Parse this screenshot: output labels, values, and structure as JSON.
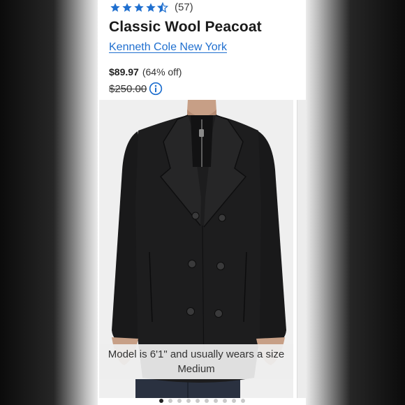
{
  "product": {
    "rating_count": "(57)",
    "title": "Classic Wool Peacoat",
    "brand": "Kenneth Cole New York",
    "price": "$89.97",
    "discount": "(64% off)",
    "original_price": "$250.00"
  },
  "rating": {
    "stars": 4.5,
    "max": 5,
    "color": "#1f6fcf"
  },
  "icons": {
    "star": "star-icon",
    "info": "info-icon"
  },
  "gallery": {
    "caption": "Model is 6'1\" and usually wears a size Medium",
    "slide_count": 10,
    "current_slide": 1
  },
  "colors": {
    "brand_link": "#1f6fcf",
    "text": "#1a1a1a",
    "coat": "#1c1c1d"
  }
}
